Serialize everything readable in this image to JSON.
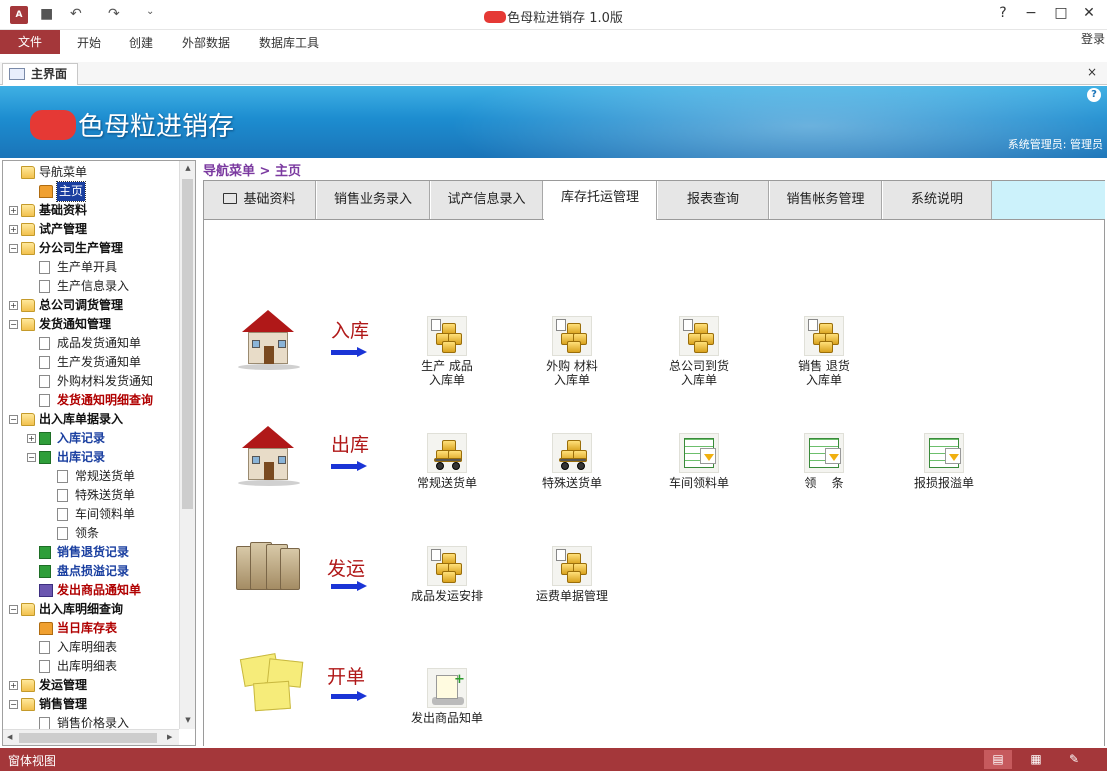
{
  "window": {
    "title": "色母粒进销存 1.0版",
    "help": "?",
    "minimize": "−",
    "maximize": "□",
    "close": "✕"
  },
  "quick_access": {
    "undo": "↶",
    "redo": "↷",
    "customize": "⌄",
    "save": "■"
  },
  "ribbon": {
    "file": "文件",
    "tabs": [
      "开始",
      "创建",
      "外部数据",
      "数据库工具"
    ],
    "login": "登录"
  },
  "doc_tab": {
    "label": "主界面",
    "close": "×"
  },
  "banner": {
    "title": "色母粒进销存",
    "user": "系统管理员: 管理员",
    "help": "?"
  },
  "nav": {
    "items": [
      {
        "label": "导航菜单",
        "icon": "folder-icon"
      },
      {
        "label": "主页",
        "icon": "home-icon"
      },
      {
        "label": "基础资料",
        "icon": "folder-icon"
      },
      {
        "label": "试产管理",
        "icon": "folder-icon"
      },
      {
        "label": "分公司生产管理",
        "icon": "folder-icon"
      },
      {
        "label": "生产单开具",
        "icon": "document-icon"
      },
      {
        "label": "生产信息录入",
        "icon": "document-icon"
      },
      {
        "label": "总公司调货管理",
        "icon": "folder-icon"
      },
      {
        "label": "发货通知管理",
        "icon": "folder-icon"
      },
      {
        "label": "成品发货通知单",
        "icon": "document-icon"
      },
      {
        "label": "生产发货通知单",
        "icon": "document-icon"
      },
      {
        "label": "外购材料发货通知",
        "icon": "document-icon"
      },
      {
        "label": "发货通知明细查询",
        "icon": "document-icon"
      },
      {
        "label": "出入库单据录入",
        "icon": "folder-icon"
      },
      {
        "label": "入库记录",
        "icon": "book-icon"
      },
      {
        "label": "出库记录",
        "icon": "book-icon"
      },
      {
        "label": "常规送货单",
        "icon": "document-icon"
      },
      {
        "label": "特殊送货单",
        "icon": "document-icon"
      },
      {
        "label": "车间领料单",
        "icon": "document-icon"
      },
      {
        "label": "领条",
        "icon": "document-icon"
      },
      {
        "label": "销售退货记录",
        "icon": "book-icon"
      },
      {
        "label": "盘点损溢记录",
        "icon": "book-icon"
      },
      {
        "label": "发出商品通知单",
        "icon": "ship-icon"
      },
      {
        "label": "出入库明细查询",
        "icon": "folder-icon"
      },
      {
        "label": "当日库存表",
        "icon": "home-icon"
      },
      {
        "label": "入库明细表",
        "icon": "document-icon"
      },
      {
        "label": "出库明细表",
        "icon": "document-icon"
      },
      {
        "label": "发运管理",
        "icon": "folder-icon"
      },
      {
        "label": "销售管理",
        "icon": "folder-icon"
      },
      {
        "label": "销售价格录入",
        "icon": "document-icon"
      }
    ]
  },
  "breadcrumb": "导航菜单 > 主页",
  "tabs": [
    "基础资料",
    "销售业务录入",
    "试产信息录入",
    "库存托运管理",
    "报表查询",
    "销售帐务管理",
    "系统说明"
  ],
  "sections": {
    "inbound": {
      "label": "入库",
      "actions": [
        {
          "line1": "生产  成品",
          "line2": "入库单"
        },
        {
          "line1": "外购  材料",
          "line2": "入库单"
        },
        {
          "line1": "总公司到货",
          "line2": "入库单"
        },
        {
          "line1": "销售  退货",
          "line2": "入库单"
        }
      ]
    },
    "outbound": {
      "label": "出库",
      "actions": [
        "常规送货单",
        "特殊送货单",
        "车间领料单",
        "领    条",
        "报损报溢单"
      ]
    },
    "shipping": {
      "label": "发运",
      "actions": [
        "成品发运安排",
        "运费单据管理"
      ]
    },
    "billing": {
      "label": "开单",
      "actions": [
        "发出商品知单"
      ]
    }
  },
  "status": {
    "text": "窗体视图"
  }
}
